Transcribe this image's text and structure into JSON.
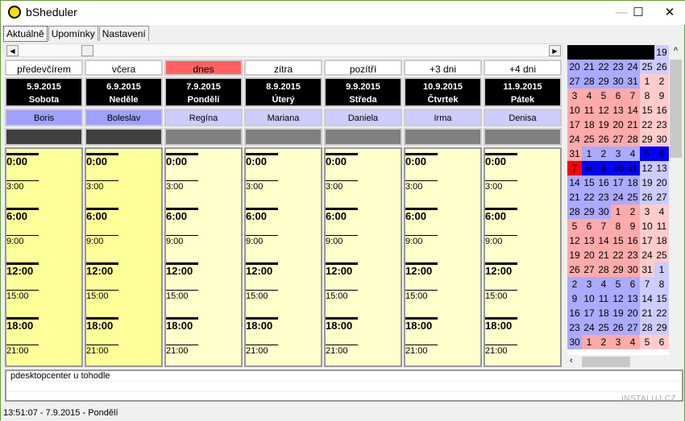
{
  "window": {
    "title": "bSheduler",
    "minimize": "—",
    "maximize": "☐",
    "close": "✕"
  },
  "tabs": [
    {
      "label": "Aktuálně",
      "active": true
    },
    {
      "label": "Upomínky"
    },
    {
      "label": "Nastavení"
    }
  ],
  "days": [
    {
      "rel": "předevčírem",
      "date": "5.9.2015",
      "weekday": "Sobota",
      "name": "Boris",
      "past": true
    },
    {
      "rel": "včera",
      "date": "6.9.2015",
      "weekday": "Neděle",
      "name": "Boleslav",
      "past": true
    },
    {
      "rel": "dnes",
      "date": "7.9.2015",
      "weekday": "Pondělí",
      "name": "Regína",
      "today": true
    },
    {
      "rel": "zítra",
      "date": "8.9.2015",
      "weekday": "Úterý",
      "name": "Mariana"
    },
    {
      "rel": "pozítří",
      "date": "9.9.2015",
      "weekday": "Středa",
      "name": "Daniela"
    },
    {
      "rel": "+3 dni",
      "date": "10.9.2015",
      "weekday": "Čtvrtek",
      "name": "Irma"
    },
    {
      "rel": "+4 dni",
      "date": "11.9.2015",
      "weekday": "Pátek",
      "name": "Denisa"
    }
  ],
  "time_slots": [
    "0:00",
    "3:00",
    "6:00",
    "9:00",
    "12:00",
    "15:00",
    "18:00",
    "21:00"
  ],
  "calendar": {
    "colors": {
      "blue": "#aaaaff",
      "blue_weekend": "#ccccff",
      "pink": "#ffaaaa",
      "pink_weekend": "#ffcccc",
      "selected": "#0000ff",
      "today": "#ff0000",
      "blank": "#000000"
    },
    "rows": [
      [
        null,
        null,
        null,
        null,
        null,
        null,
        "19b"
      ],
      [
        "20b",
        "21b",
        "22b",
        "23b",
        "24b",
        "25b",
        "26b"
      ],
      [
        "27b",
        "28b",
        "29b",
        "30b",
        "31b",
        "1p",
        "2p"
      ],
      [
        "3p",
        "4p",
        "5p",
        "6p",
        "7p",
        "8p",
        "9p"
      ],
      [
        "10p",
        "11p",
        "12p",
        "13p",
        "14p",
        "15p",
        "16p"
      ],
      [
        "17p",
        "18p",
        "19p",
        "20p",
        "21p",
        "22p",
        "23p"
      ],
      [
        "24p",
        "25p",
        "26p",
        "27p",
        "28p",
        "29p",
        "30p"
      ],
      [
        "31p",
        "1b",
        "2b",
        "3b",
        "4b",
        "5s",
        "6s"
      ],
      [
        "7t",
        "8s",
        "9s",
        "10s",
        "11s",
        "12b",
        "13b"
      ],
      [
        "14b",
        "15b",
        "16b",
        "17b",
        "18b",
        "19b",
        "20b"
      ],
      [
        "21b",
        "22b",
        "23b",
        "24b",
        "25b",
        "26b",
        "27b"
      ],
      [
        "28b",
        "29b",
        "30b",
        "1p",
        "2p",
        "3p",
        "4p"
      ],
      [
        "5p",
        "6p",
        "7p",
        "8p",
        "9p",
        "10p",
        "11p"
      ],
      [
        "12p",
        "13p",
        "14p",
        "15p",
        "16p",
        "17p",
        "18p"
      ],
      [
        "19p",
        "20p",
        "21p",
        "22p",
        "23p",
        "24p",
        "25p"
      ],
      [
        "26p",
        "27p",
        "28p",
        "29p",
        "30p",
        "31p",
        "1b"
      ],
      [
        "2b",
        "3b",
        "4b",
        "5b",
        "6b",
        "7b",
        "8b"
      ],
      [
        "9b",
        "10b",
        "11b",
        "12b",
        "13b",
        "14b",
        "15b"
      ],
      [
        "16b",
        "17b",
        "18b",
        "19b",
        "20b",
        "21b",
        "22b"
      ],
      [
        "23b",
        "24b",
        "25b",
        "26b",
        "27b",
        "28b",
        "29b"
      ],
      [
        "30b",
        "1p",
        "2p",
        "3p",
        "4p",
        "5p",
        "6p"
      ]
    ]
  },
  "notes": [
    "pdesktopcenter u tohodle",
    "",
    ""
  ],
  "status": "13:51:07 - 7.9.2015 - Pondělí",
  "watermark": "INSTALUJ.CZ"
}
